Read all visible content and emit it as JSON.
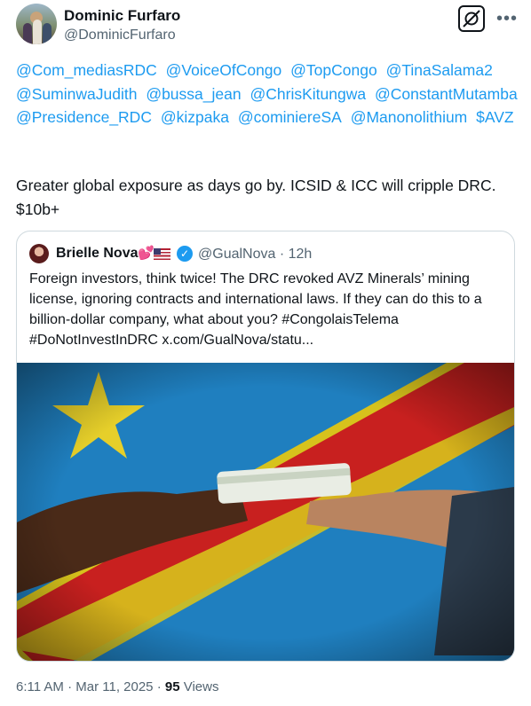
{
  "author": {
    "name": "Dominic Furfaro",
    "handle": "@DominicFurfaro"
  },
  "mentions": [
    "@Com_mediasRDC",
    "@VoiceOfCongo",
    "@TopCongo",
    "@TinaSalama2",
    "@SuminwaJudith",
    "@bussa_jean",
    "@ChrisKitungwa",
    "@ConstantMutamba",
    "@Presidence_RDC",
    "@kizpaka",
    "@cominiereSA",
    "@Manonolithium",
    "$AVZ"
  ],
  "tweet_text": "Greater global exposure as days go by. ICSID & ICC will cripple DRC. $10b+",
  "quoted": {
    "name": "Brielle Nova",
    "emoji": "💕",
    "handle": "@GualNova · 12h",
    "text": "Foreign investors, think twice! The DRC revoked AVZ Minerals’ mining license, ignoring contracts and international laws. If they can do this to a billion-dollar company, what about you? #CongolaisTelema #DoNotInvestInDRC  x.com/GualNova/statu..."
  },
  "meta": {
    "time": "6:11 AM · Mar 11, 2025 · ",
    "views_count": "95",
    "views_label": " Views"
  },
  "colors": {
    "link": "#1d9bf0",
    "secondary": "#536471",
    "border": "#cfd9de"
  },
  "icons": [
    "grok-icon",
    "more-icon",
    "verified-badge-icon",
    "us-flag-icon"
  ]
}
